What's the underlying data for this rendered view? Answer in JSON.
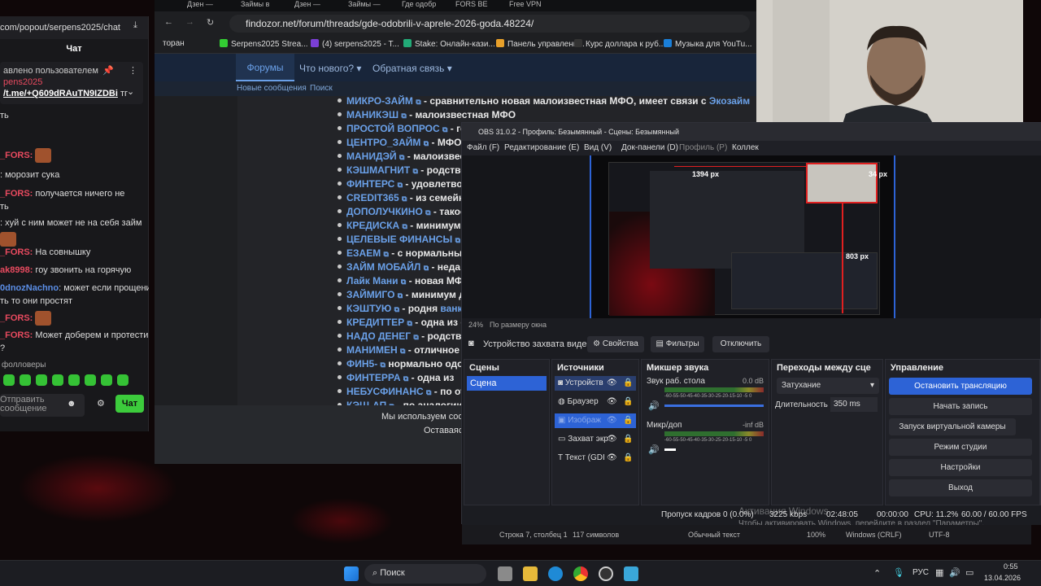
{
  "chat": {
    "url": "com/popout/serpens2025/chat",
    "title": "Чат",
    "pinned": {
      "label": "авлено пользователем",
      "user": "pens2025",
      "link": "/t.me/+Q609dRAuTN9IZDBi",
      "link_tail": "тг"
    },
    "first_line": "ть",
    "messages": [
      {
        "nick": "_FORS:",
        "text": "",
        "emote": true
      },
      {
        "nick": "",
        "text": ": морозит сука"
      },
      {
        "nick": "_FORS:",
        "text": " получается ничего не",
        "cont": "ть"
      },
      {
        "nick": "",
        "text": ": хуй с ним может не на себя займ"
      },
      {
        "nick": "",
        "text": "",
        "emote": true
      },
      {
        "nick": "_FORS:",
        "text": " На совнышку"
      },
      {
        "nick": "ak8998:",
        "text": " гоу звонить на горячую"
      },
      {
        "nick": "0dnozNachno",
        "text": ": может если прощение",
        "cont": "ть то они простят"
      },
      {
        "nick": "_FORS:",
        "text": "",
        "emote": true
      },
      {
        "nick": "_FORS:",
        "text": " Может доберем и протестим",
        "cont": "?"
      }
    ],
    "followers_label": "фолловеры",
    "input_placeholder": "Отправить сообщение",
    "send_label": "Чат"
  },
  "browser": {
    "tabs": [
      "Дзен —",
      "Займы в",
      "Дзен —",
      "Займы —",
      "Где одобр",
      "FORS BE",
      "Free VPN"
    ],
    "url": "findozor.net/forum/threads/gde-odobrili-v-aprele-2026-goda.48224/",
    "bookmarks": [
      "торан",
      "Serpens2025 Strea...",
      "(4) serpens2025 - T...",
      "Stake: Онлайн-кази...",
      "Панель управлени...",
      "Курс доллара к руб...",
      "Музыка для YouTu..."
    ],
    "forum_nav": [
      "Форумы",
      "Что нового?",
      "Обратная связь"
    ],
    "forum_sub": [
      "Новые сообщения",
      "Поиск"
    ],
    "list": [
      {
        "name": "МИКРО-ЗАЙМ",
        "text": " - сравнительно новая малоизвестная МФО, имеет связи с ",
        "link": "Экозайм"
      },
      {
        "name": "МАНИКЭШ",
        "text": " - малоизвестная МФО"
      },
      {
        "name": "ПРОСТОЙ ВОПРОС",
        "text": " - го"
      },
      {
        "name": "ЦЕНТРО_ЗАЙМ",
        "text": " - МФО"
      },
      {
        "name": "МАНИДЭЙ",
        "text": " - малоизвес"
      },
      {
        "name": "КЭШМАГНИТ",
        "text": " - родстве"
      },
      {
        "name": "ФИНТЕРС",
        "text": " - удовлетвор"
      },
      {
        "name": "CREDIT365",
        "text": " - из семейк"
      },
      {
        "name": "ДОПОЛУЧКИНО",
        "text": " - такое"
      },
      {
        "name": "КРЕДИСКА",
        "text": " - минимум"
      },
      {
        "name": "ЦЕЛЕВЫЕ ФИНАНСЫ",
        "text": " -"
      },
      {
        "name": "ЕЗАЕМ",
        "text": " - с нормальны"
      },
      {
        "name": "ЗАЙМ МОБАЙЛ",
        "text": " - неда"
      },
      {
        "name": "Лайк Мани",
        "text": " - новая МФ"
      },
      {
        "name": "ЗАЙМИГО",
        "text": " - минимум да"
      },
      {
        "name": "КЭШТУЮ",
        "text": " - родня ",
        "link": "ванкл"
      },
      {
        "name": "КРЕДИТТЕР",
        "text": " - одна из с"
      },
      {
        "name": "НАДО ДЕНЕГ",
        "text": " - родстве"
      },
      {
        "name": "МАНИМЕН",
        "text": " - отличное"
      },
      {
        "name": "ФИН5-",
        "text": " нормально одо"
      },
      {
        "name": "ФИНТЕРРА",
        "text": " - одна из"
      },
      {
        "name": "НЕБУСФИНАНС",
        "text": " - по от"
      },
      {
        "name": "КЭШ-АП",
        "text": " - по аналогии"
      }
    ],
    "cookie": [
      "Мы используем coo",
      "Оставаясь"
    ]
  },
  "obs": {
    "title": "OBS 31.0.2 - Профиль: Безымянный - Сцены: Безымянный",
    "menu": [
      "Файл (F)",
      "Редактирование (E)",
      "Вид (V)",
      "Док-панели (D)",
      "Профиль (P)",
      "Коллек"
    ],
    "preview_labels": {
      "w": "1394 px",
      "h": "803 px",
      "r": "34 px"
    },
    "zoom": "24%",
    "fit": "По размеру окна",
    "source_toolbar": {
      "name": "Устройство захвата видео",
      "props": "Свойства",
      "filters": "Фильтры",
      "disable": "Отключить"
    },
    "scenes": {
      "title": "Сцены",
      "items": [
        "Сцена"
      ]
    },
    "sources": {
      "title": "Источники",
      "items": [
        "Устройств",
        "Браузер",
        "Изображ",
        "Захват экр",
        "Текст (GDI"
      ]
    },
    "mixer": {
      "title": "Микшер звука",
      "ch1": "Звук раб. стола",
      "ch1_db": "0.0 dB",
      "ch2": "Микр/доп",
      "ch2_db": "-inf dB",
      "scale": "-60-55-50-45-40-35-30-25-20-15-10 -5 0"
    },
    "transitions": {
      "title": "Переходы между сце",
      "type": "Затухание",
      "dur_label": "Длительность",
      "dur": "350 ms"
    },
    "controls": {
      "title": "Управление",
      "buttons": [
        "Остановить трансляцию",
        "Начать запись",
        "Запуск виртуальной камеры",
        "Режим студии",
        "Настройки",
        "Выход"
      ]
    },
    "status": {
      "frames": "Пропуск кадров 0 (0.0%)",
      "kbps": "3225 kbps",
      "time1": "02:48:05",
      "time2": "00:00:00",
      "cpu": "CPU: 11.2%",
      "fps": "60.00 / 60.00 FPS"
    },
    "watermark": [
      "Активация Windows",
      "Чтобы активировать Windows, перейдите в раздел \"Параметры\"."
    ]
  },
  "notepad_status": [
    "Строка 7, столбец 1",
    "117 символов",
    "Обычный текст",
    "100%",
    "Windows (CRLF)",
    "UTF-8"
  ],
  "taskbar": {
    "search": "Поиск",
    "lang": "РУС",
    "time": "0:55",
    "date": "13.04.2026"
  }
}
